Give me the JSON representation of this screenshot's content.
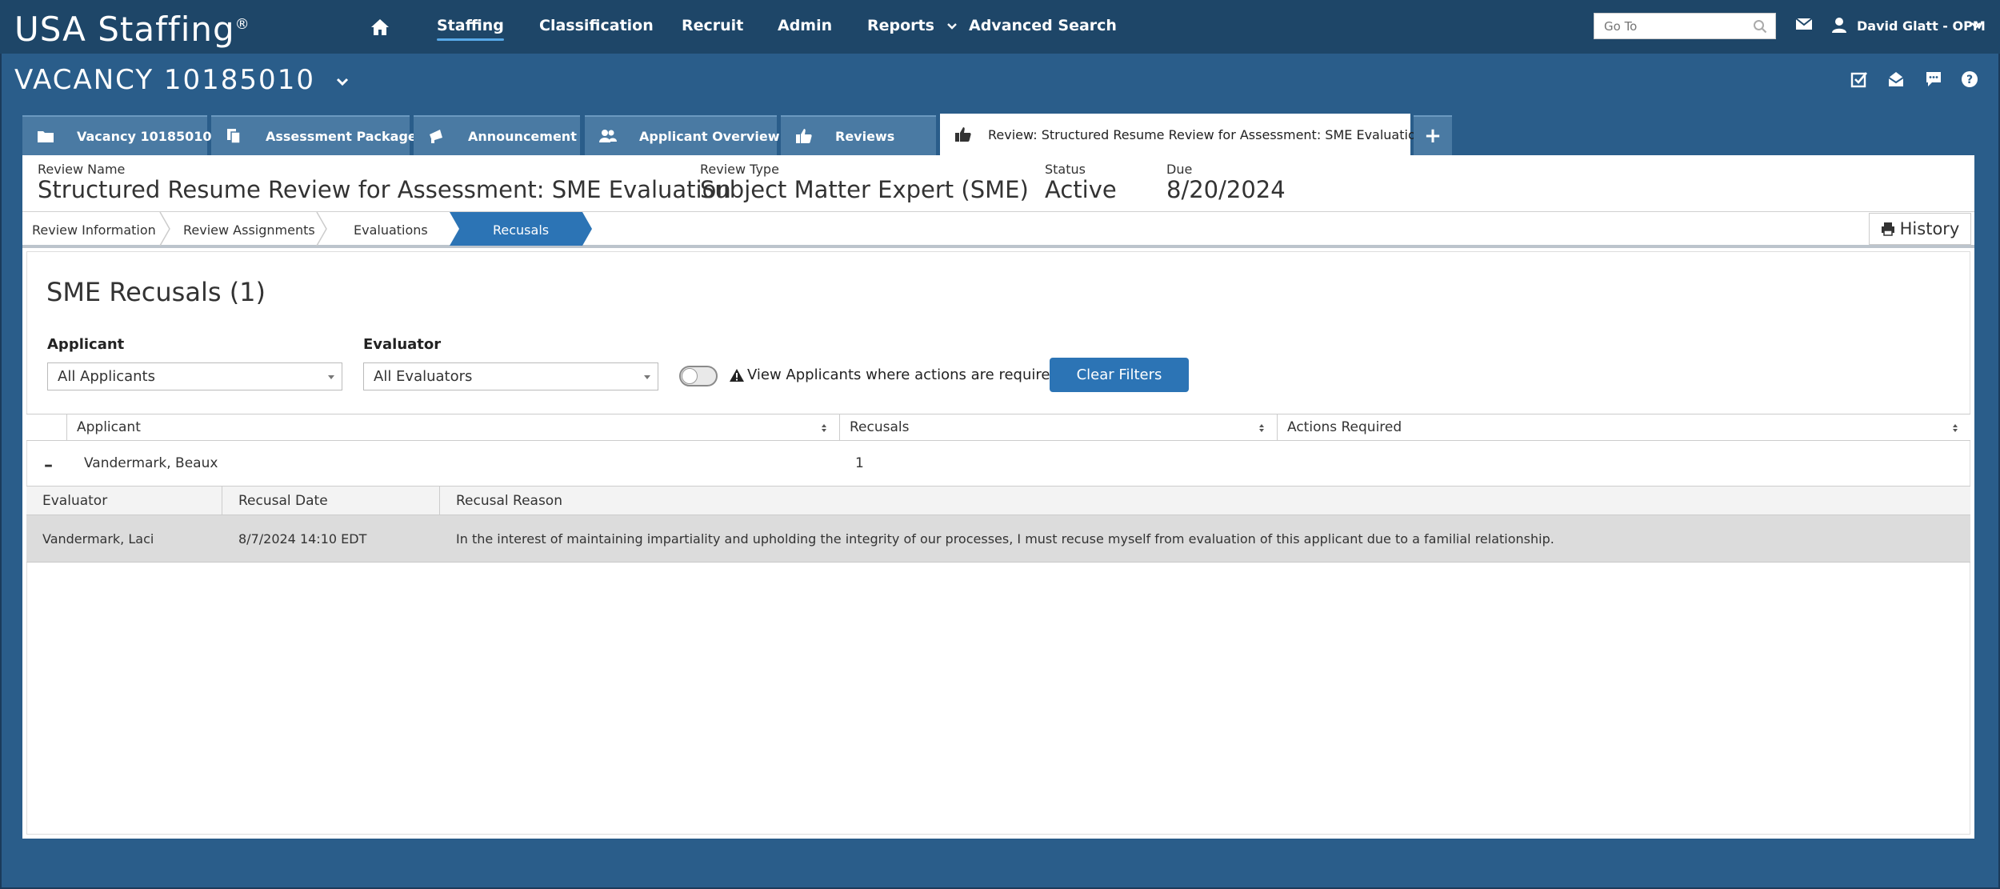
{
  "app": {
    "logo_text": "USA Staffing",
    "logo_mark": "®"
  },
  "nav": {
    "items": [
      "Staffing",
      "Classification",
      "Recruit",
      "Admin",
      "Reports",
      "Advanced Search"
    ],
    "active": "Staffing",
    "goto_placeholder": "Go To",
    "user_name": "David Glatt - OPM"
  },
  "vacancy": {
    "title": "VACANCY 10185010"
  },
  "tabs": [
    {
      "label": "Vacancy 10185010",
      "icon": "folder-icon"
    },
    {
      "label": "Assessment Package",
      "icon": "documents-icon"
    },
    {
      "label": "Announcement",
      "icon": "megaphone-icon"
    },
    {
      "label": "Applicant Overview",
      "icon": "people-icon"
    },
    {
      "label": "Reviews",
      "icon": "thumbs-up-icon"
    },
    {
      "label": "Review: Structured Resume Review for Assessment: SME Evaluation",
      "icon": "thumbs-up-icon",
      "active": true
    }
  ],
  "tab_add_label": "+",
  "review": {
    "name_label": "Review Name",
    "name": "Structured Resume Review for Assessment: SME Evaluation",
    "type_label": "Review Type",
    "type": "Subject Matter Expert (SME)",
    "status_label": "Status",
    "status": "Active",
    "due_label": "Due",
    "due": "8/20/2024"
  },
  "steps": [
    "Review Information",
    "Review Assignments",
    "Evaluations",
    "Recusals"
  ],
  "active_step": "Recusals",
  "history_label": "History",
  "page": {
    "title": "SME Recusals (1)",
    "applicant_filter_label": "Applicant",
    "applicant_filter_value": "All Applicants",
    "evaluator_filter_label": "Evaluator",
    "evaluator_filter_value": "All Evaluators",
    "toggle_label": "View Applicants where actions are required",
    "clear_filters_label": "Clear Filters"
  },
  "table": {
    "columns": [
      "Applicant",
      "Recusals",
      "Actions Required"
    ],
    "rows": [
      {
        "applicant": "Vandermark, Beaux",
        "recusals": "1",
        "collapse_symbol": "–",
        "sub_columns": [
          "Evaluator",
          "Recusal Date",
          "Recusal Reason"
        ],
        "sub_rows": [
          {
            "evaluator": "Vandermark, Laci",
            "date": "8/7/2024 14:10 EDT",
            "reason": "In the interest of maintaining impartiality and upholding the integrity of our processes, I must recuse myself from evaluation of this applicant due to a familial relationship."
          }
        ]
      }
    ]
  },
  "colors": {
    "page_bg": "#2a5d8a",
    "nav_bg": "#1e4668",
    "tab_bg": "#4a7aa3",
    "accent_blue": "#2c74b5",
    "nav_underline": "#58a9e8"
  }
}
